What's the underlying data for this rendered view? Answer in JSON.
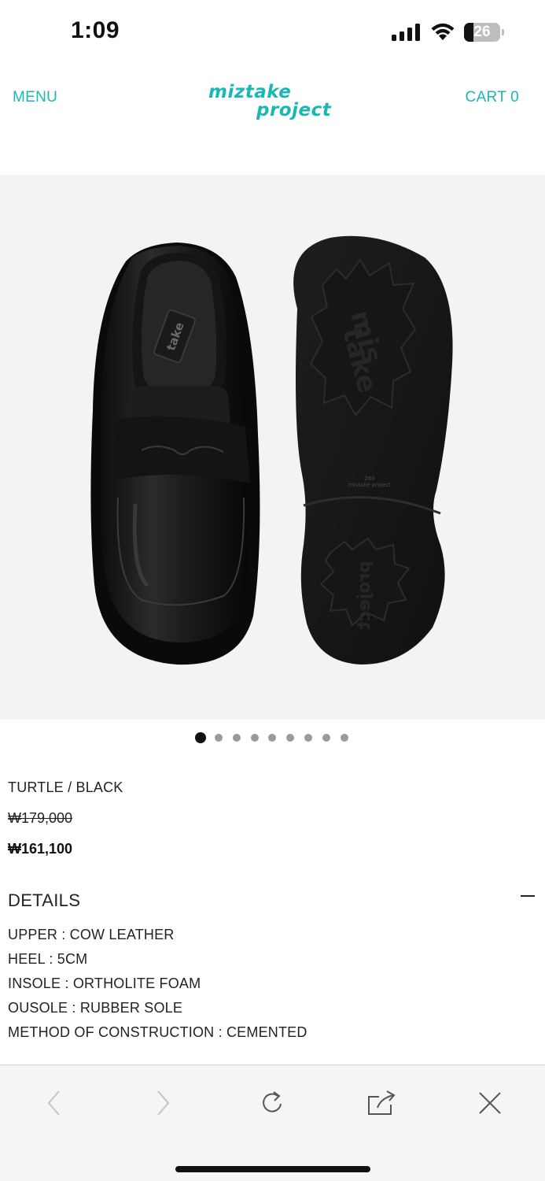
{
  "status_bar": {
    "time": "1:09",
    "battery_level": "26",
    "battery_fraction": 0.26
  },
  "header": {
    "menu_label": "MENU",
    "logo_line1": "miztake",
    "logo_line2": "project",
    "cart_label": "CART",
    "cart_count": "0",
    "accent_color": "#1fb5b5"
  },
  "gallery": {
    "image_alt_icon": "loafer-shoe-image",
    "sole_text_1": "mis",
    "sole_text_2": "take",
    "sole_size": "260",
    "sole_brand": "mistake project",
    "heel_text": "project",
    "insole_text": "take",
    "slide_count": 9,
    "active_slide": 1
  },
  "product": {
    "name": "TURTLE / BLACK",
    "price_original": "₩179,000",
    "price_sale": "₩161,100"
  },
  "details": {
    "title": "DETAILS",
    "items": [
      "UPPER : COW LEATHER",
      "HEEL : 5CM",
      "INSOLE : ORTHOLITE FOAM",
      "OUSOLE : RUBBER SOLE",
      "METHOD OF CONSTRUCTION : CEMENTED"
    ]
  },
  "browser_toolbar": {
    "buttons": [
      "back-icon",
      "forward-icon",
      "reload-icon",
      "share-icon",
      "close-icon"
    ]
  }
}
